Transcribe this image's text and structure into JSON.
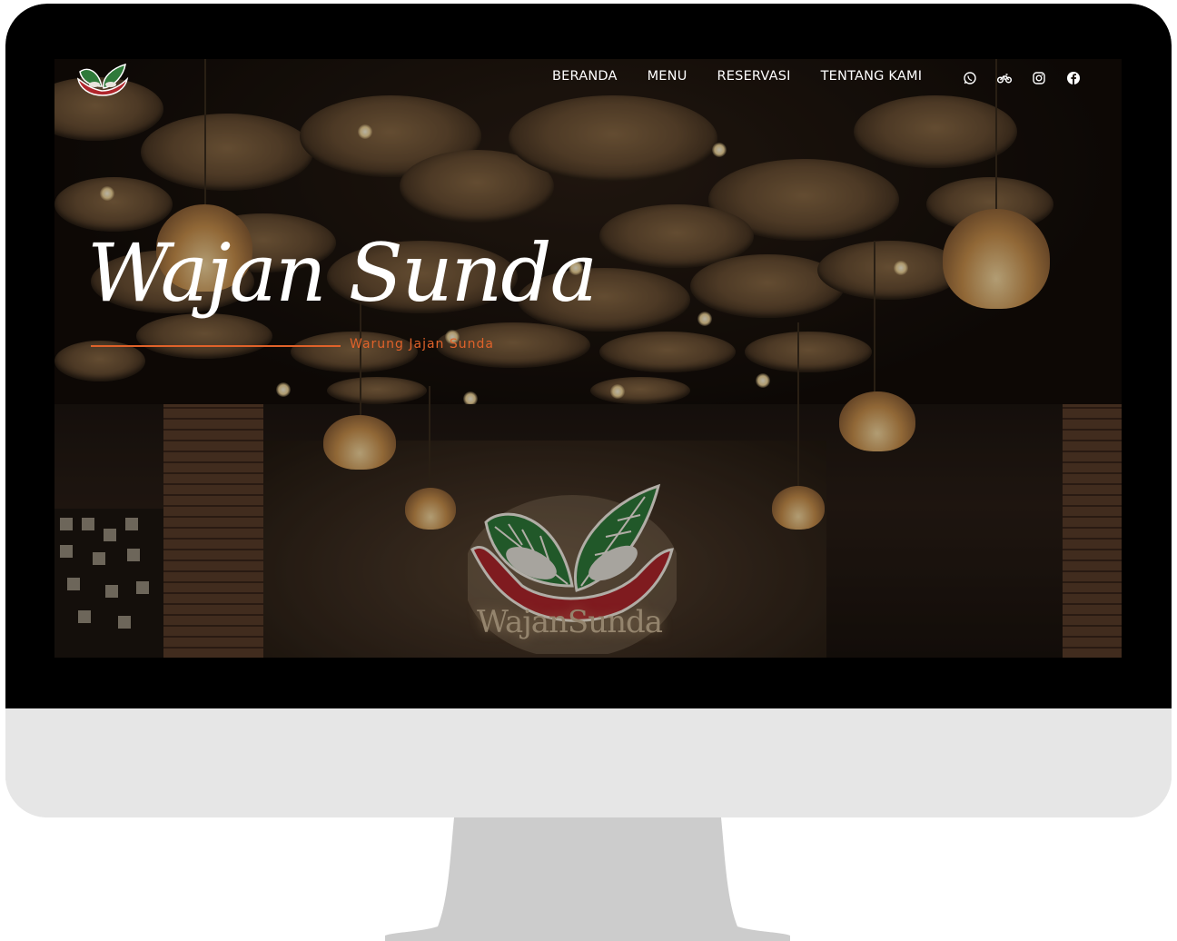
{
  "nav": {
    "items": [
      {
        "label": "BERANDA"
      },
      {
        "label": "MENU"
      },
      {
        "label": "RESERVASI"
      },
      {
        "label": "TENTANG KAMI"
      }
    ],
    "icons": [
      "whatsapp-icon",
      "motorbike-icon",
      "instagram-icon",
      "facebook-icon"
    ]
  },
  "hero": {
    "title": "Wajan Sunda",
    "subtitle": "Warung Jajan Sunda"
  },
  "sign": {
    "text": "WajanSunda"
  },
  "colors": {
    "accent": "#e0622a",
    "leaf_green": "#2f7a3a",
    "wok_red": "#b0262c",
    "bezel": "#000000",
    "chin": "#e6e6e6",
    "stand": "#cccccc"
  }
}
